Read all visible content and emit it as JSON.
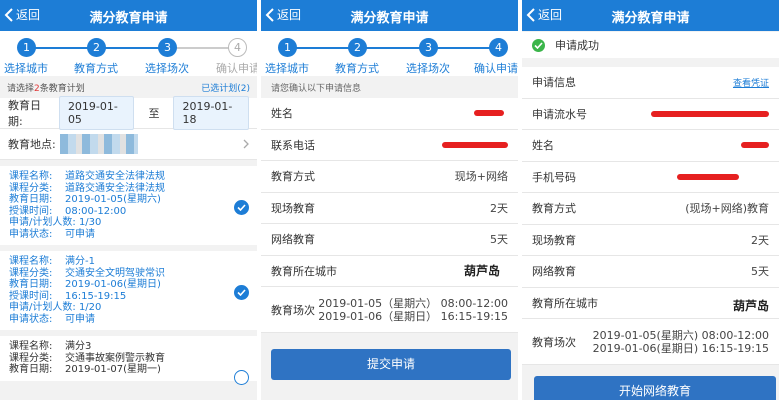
{
  "back_label": "返回",
  "app_title": "满分教育申请",
  "steps": [
    {
      "num": "1",
      "label": "选择城市"
    },
    {
      "num": "2",
      "label": "教育方式"
    },
    {
      "num": "3",
      "label": "选择场次"
    },
    {
      "num": "4",
      "label": "确认申请"
    }
  ],
  "panel1": {
    "plan_prefix": "请选择",
    "plan_count": "2",
    "plan_suffix": "条教育计划",
    "selected_link": "已选计划(2)",
    "date_label": "教育日期:",
    "date_from": "2019-01-05",
    "date_to_sep": "至",
    "date_to": "2019-01-18",
    "place_label": "教育地点:",
    "field_labels": [
      "课程名称:",
      "课程分类:",
      "教育日期:",
      "授课时间:",
      "申请/计划人数:",
      "申请状态:"
    ],
    "courses": [
      {
        "name": "道路交通安全法律法规",
        "category": "道路交通安全法律法规",
        "date": "2019-01-05(星期六)",
        "time": "08:00-12:00",
        "count": "1/30",
        "status": "可申请"
      },
      {
        "name": "满分-1",
        "category": "交通安全文明驾驶常识",
        "date": "2019-01-06(星期日)",
        "time": "16:15-19:15",
        "count": "1/20",
        "status": "可申请"
      },
      {
        "name": "满分3",
        "category": "交通事故案例警示教育",
        "date": "2019-01-07(星期一)"
      }
    ]
  },
  "panel2": {
    "confirm_hint": "请您确认以下申请信息",
    "name_label": "姓名",
    "phone_label": "联系电话",
    "method_label": "教育方式",
    "method_value": "现场+网络",
    "onsite_label": "现场教育",
    "onsite_value": "2天",
    "online_label": "网络教育",
    "online_value": "5天",
    "city_label": "教育所在城市",
    "city_value": "葫芦岛",
    "session_label": "教育场次",
    "session_line1": "2019-01-05（星期六） 08:00-12:00",
    "session_line2": "2019-01-06（星期日） 16:15-19:15",
    "submit_label": "提交申请"
  },
  "panel3": {
    "success_text": "申请成功",
    "info_label": "申请信息",
    "view_link": "查看凭证",
    "serial_label": "申请流水号",
    "name_label": "姓名",
    "mobile_label": "手机号码",
    "method_label": "教育方式",
    "method_value": "(现场+网络)教育",
    "onsite_label": "现场教育",
    "onsite_value": "2天",
    "online_label": "网络教育",
    "online_value": "5天",
    "city_label": "教育所在城市",
    "city_value": "葫芦岛",
    "session_label": "教育场次",
    "session_line1": "2019-01-05(星期六) 08:00-12:00",
    "session_line2": "2019-01-06(星期日) 16:15-19:15",
    "start_label": "开始网络教育"
  },
  "colors": {
    "primary": "#1d7dd6",
    "button": "#2f73c3",
    "success": "#3bb54a",
    "redact": "#e62020"
  }
}
